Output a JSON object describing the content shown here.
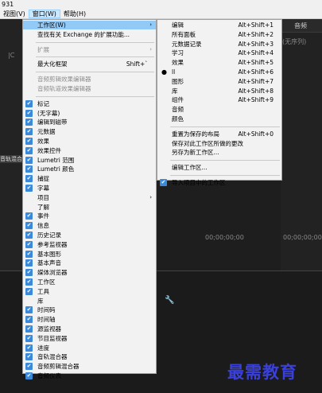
{
  "window": {
    "title": "931"
  },
  "menubar": {
    "items": [
      "视图(V)",
      "窗口(W)",
      "帮助(H)"
    ],
    "active": "窗口(W)"
  },
  "background": {
    "audio_strip": "音轨混合器",
    "top_right_tab": "音频",
    "no_sequence": "(无序列)",
    "timecode1": "00;00;00;00",
    "timecode2": "00;00;00;00",
    "side_marker": "|C"
  },
  "window_menu": [
    {
      "label": "工作区(W)",
      "submenu": true,
      "highlight": true
    },
    {
      "label": "查找有关 Exchange 的扩展功能..."
    },
    {
      "sep": true
    },
    {
      "label": "扩展",
      "submenu": true,
      "disabled": true
    },
    {
      "sep": true
    },
    {
      "label": "最大化框架",
      "shortcut": "Shift+`"
    },
    {
      "sep": true
    },
    {
      "label": "音频剪辑效果编辑器",
      "disabled": true
    },
    {
      "label": "音频轨道效果编辑器",
      "disabled": true
    },
    {
      "sep": true
    },
    {
      "label": "标记",
      "checked": true
    },
    {
      "label": "(无字幕)",
      "checked": true
    },
    {
      "label": "编辑到磁带",
      "checked": true
    },
    {
      "label": "元数据",
      "checked": true
    },
    {
      "label": "效果",
      "checked": true
    },
    {
      "label": "效果控件",
      "checked": true
    },
    {
      "label": "Lumetri 范围",
      "checked": true
    },
    {
      "label": "Lumetri 颜色",
      "checked": true
    },
    {
      "label": "捕捉",
      "checked": true
    },
    {
      "label": "字幕",
      "checked": true
    },
    {
      "label": "项目",
      "submenu": true
    },
    {
      "label": "了解"
    },
    {
      "label": "事件",
      "checked": true
    },
    {
      "label": "信息",
      "checked": true
    },
    {
      "label": "历史记录",
      "checked": true
    },
    {
      "label": "参考监视器",
      "checked": true
    },
    {
      "label": "基本图形",
      "checked": true
    },
    {
      "label": "基本声音",
      "checked": true
    },
    {
      "label": "媒体浏览器",
      "checked": true
    },
    {
      "label": "工作区",
      "checked": true
    },
    {
      "label": "工具",
      "checked": true
    },
    {
      "label": "库"
    },
    {
      "label": "时间码",
      "checked": true
    },
    {
      "label": "时间轴",
      "checked": true
    },
    {
      "label": "源监视器",
      "checked": true
    },
    {
      "label": "节目监视器",
      "checked": true
    },
    {
      "label": "进度",
      "checked": true
    },
    {
      "label": "音轨混合器",
      "checked": true
    },
    {
      "label": "音频剪辑混合器",
      "checked": true
    },
    {
      "label": "音频仪表",
      "checked": true
    }
  ],
  "workspace_submenu": [
    {
      "label": "编辑",
      "shortcut": "Alt+Shift+1"
    },
    {
      "label": "所有面板",
      "shortcut": "Alt+Shift+2"
    },
    {
      "label": "元数据记录",
      "shortcut": "Alt+Shift+3"
    },
    {
      "label": "学习",
      "shortcut": "Alt+Shift+4"
    },
    {
      "label": "效果",
      "shortcut": "Alt+Shift+5"
    },
    {
      "label": "ll",
      "shortcut": "Alt+Shift+6",
      "current": true
    },
    {
      "label": "图形",
      "shortcut": "Alt+Shift+7"
    },
    {
      "label": "库",
      "shortcut": "Alt+Shift+8"
    },
    {
      "label": "组件",
      "shortcut": "Alt+Shift+9"
    },
    {
      "label": "音频"
    },
    {
      "label": "颜色"
    },
    {
      "sep": true
    },
    {
      "label": "重置为保存的布局",
      "shortcut": "Alt+Shift+0"
    },
    {
      "label": "保存对此工作区所做的更改"
    },
    {
      "label": "另存为新工作区..."
    },
    {
      "sep": true
    },
    {
      "label": "编辑工作区..."
    },
    {
      "sep": true
    },
    {
      "label": "导入项目中的工作区",
      "checked": true
    }
  ],
  "watermark": "最需教育",
  "colors": {
    "check": "#3b89d9",
    "highlight": "#91c9f7",
    "watermark": "#3a40d8"
  }
}
